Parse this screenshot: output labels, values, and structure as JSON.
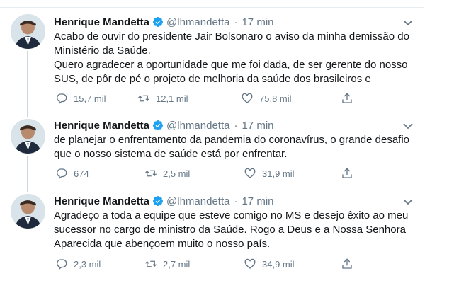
{
  "tweets": [
    {
      "name": "Henrique Mandetta",
      "handle": "@lhmandetta",
      "separator": "·",
      "time": "17 min",
      "lines": [
        "Acabo de ouvir do presidente Jair Bolsonaro o aviso da minha demissão do",
        "Ministério da Saúde.",
        "Quero agradecer a oportunidade que me foi dada, de ser gerente do nosso",
        "SUS, de pôr de pé o projeto de melhoria da saúde dos brasileiros e"
      ],
      "replies": "15,7 mil",
      "retweets": "12,1 mil",
      "likes": "75,8 mil"
    },
    {
      "name": "Henrique Mandetta",
      "handle": "@lhmandetta",
      "separator": "·",
      "time": "17 min",
      "lines": [
        "de planejar o enfrentamento da pandemia do coronavírus, o grande desafio",
        "que o nosso sistema de saúde está por enfrentar."
      ],
      "replies": "674",
      "retweets": "2,5 mil",
      "likes": "31,9 mil"
    },
    {
      "name": "Henrique Mandetta",
      "handle": "@lhmandetta",
      "separator": "·",
      "time": "17 min",
      "lines": [
        "Agradeço a toda a equipe que esteve comigo no MS e desejo êxito ao meu",
        "sucessor no cargo de ministro da Saúde. Rogo a Deus e a Nossa Senhora",
        "Aparecida que abençoem muito o nosso país."
      ],
      "replies": "2,3 mil",
      "retweets": "2,7 mil",
      "likes": "34,9 mil"
    }
  ],
  "colors": {
    "verified": "#1da1f2",
    "muted": "#657786",
    "thread_line": "#ccd6dd"
  },
  "icons": [
    "verified-badge-icon",
    "chevron-down-icon",
    "reply-icon",
    "retweet-icon",
    "like-icon",
    "share-icon"
  ]
}
